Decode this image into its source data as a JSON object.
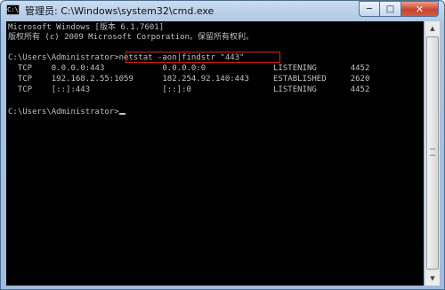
{
  "window": {
    "title": "管理员: C:\\Windows\\system32\\cmd.exe",
    "icon": "cmd-icon",
    "icon_label": "C:\\",
    "minimize_label": "─",
    "maximize_label": "□",
    "close_label": "✕"
  },
  "console": {
    "lines": [
      "Microsoft Windows [版本 6.1.7601]",
      "版权所有 (c) 2009 Microsoft Corporation。保留所有权利。",
      "",
      "C:\\Users\\Administrator>netstat -aon|findstr \"443\"",
      "  TCP    0.0.0.0:443            0.0.0.0:0              LISTENING       4452",
      "  TCP    192.168.2.55:1059      182.254.92.140:443     ESTABLISHED     2620",
      "  TCP    [::]:443               [::]:0                 LISTENING       4452",
      "",
      "C:\\Users\\Administrator>"
    ]
  },
  "colors": {
    "console_bg": "#000000",
    "console_text": "#c0c0c0",
    "highlight_border": "#e0201a"
  }
}
